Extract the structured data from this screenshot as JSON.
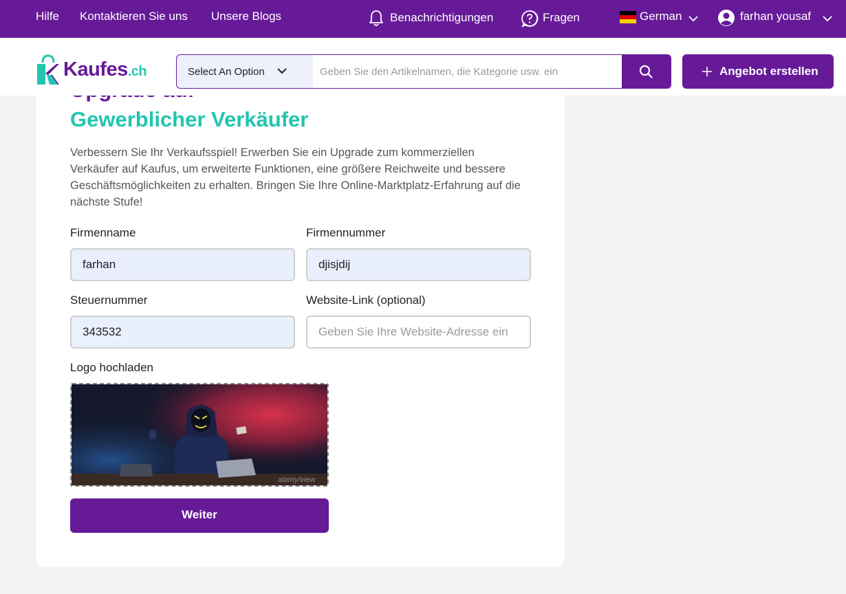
{
  "topbar": {
    "help": "Hilfe",
    "contact": "Kontaktieren Sie uns",
    "blogs": "Unsere Blogs",
    "notifications": "Benachrichtigungen",
    "questions": "Fragen",
    "language": "German",
    "user": "farhan yousaf"
  },
  "header": {
    "logo_main": "Kaufes",
    "logo_suffix": ".ch",
    "category_select": "Select An Option",
    "search_placeholder": "Geben Sie den Artikelnamen, die Kategorie usw. ein",
    "create_button": "Angebot erstellen"
  },
  "form": {
    "title_line1": "Upgrade auf",
    "title_line2": "Gewerblicher Verkäufer",
    "description": "Verbessern Sie Ihr Verkaufsspiel! Erwerben Sie ein Upgrade zum kommerziellen Verkäufer auf Kaufus, um erweiterte Funktionen, eine größere Reichweite und bessere Geschäftsmöglichkeiten zu erhalten. Bringen Sie Ihre Online-Marktplatz-Erfahrung auf die nächste Stufe!",
    "company_name_label": "Firmenname",
    "company_name_value": "farhan",
    "company_number_label": "Firmennummer",
    "company_number_value": "djisjdij",
    "tax_number_label": "Steuernummer",
    "tax_number_value": "343532",
    "website_label": "Website-Link (optional)",
    "website_value": "",
    "website_placeholder": "Geben Sie Ihre Website-Adresse ein",
    "logo_label": "Logo hochladen",
    "logo_watermark": "alamy/view",
    "next_button": "Weiter"
  },
  "colors": {
    "brand_purple": "#661a98",
    "brand_teal": "#22c5b0"
  }
}
